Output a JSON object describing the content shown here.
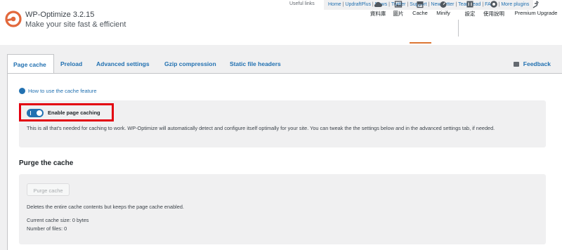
{
  "header": {
    "title": "WP-Optimize 3.2.15",
    "tagline": "Make your site fast & efficient",
    "useful_links_label": "Useful links",
    "useful_links": [
      "Home",
      "UpdraftPlus",
      "News",
      "Twitter",
      "Support",
      "Newsletter",
      "Team lead",
      "FAQs",
      "More plugins"
    ]
  },
  "nav": {
    "items": [
      {
        "label": "資料庫",
        "icon": "cloud-icon"
      },
      {
        "label": "圖片",
        "icon": "images-icon"
      },
      {
        "label": "Cache",
        "icon": "archive-icon",
        "active": true
      },
      {
        "label": "Minify",
        "icon": "dashboard-icon"
      },
      {
        "label": "設定",
        "icon": "settings-icon"
      },
      {
        "label": "使用說明",
        "icon": "help-icon"
      },
      {
        "label": "Premium Upgrade",
        "icon": "plug-icon"
      }
    ]
  },
  "tabs": {
    "items": [
      "Page cache",
      "Preload",
      "Advanced settings",
      "Gzip compression",
      "Static file headers"
    ],
    "active": "Page cache",
    "feedback_label": "Feedback"
  },
  "main": {
    "howto_link": "How to use the cache feature",
    "toggle_label": "Enable page caching",
    "toggle_on": true,
    "description": "This is all that's needed for caching to work. WP-Optimize will automatically detect and configure itself optimally for your site. You can tweak the the settings below and in the advanced settings tab, if needed.",
    "purge_title": "Purge the cache",
    "purge_button": "Purge cache",
    "purge_description": "Deletes the entire cache contents but keeps the page cache enabled.",
    "cache_size": "Current cache size: 0 bytes",
    "num_files": "Number of files: 0"
  },
  "colors": {
    "accent": "#2271b1",
    "brand_orange": "#dc7633",
    "highlight_red": "#e3000f"
  }
}
